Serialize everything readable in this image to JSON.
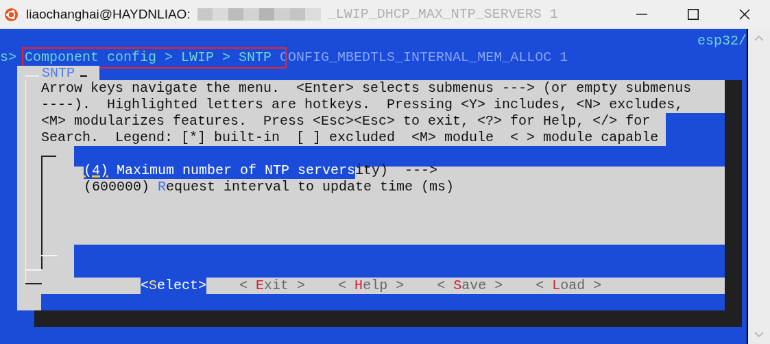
{
  "window": {
    "title": "liaochanghai@HAYDNLIAO:",
    "title_ghost": "_LWIP_DHCP_MAX_NTP_SERVERS 1"
  },
  "terminal": {
    "prompt_tail": "s>",
    "breadcrumb": "Component config > LWIP > SNTP",
    "breadcrumb_highlighted": true,
    "ghost_line": "CONFIG_MBEDTLS_INTERNAL_MEM_ALLOC 1",
    "path_tail": "esp32/"
  },
  "dialog": {
    "title": "SNTP",
    "help_lines": [
      "Arrow keys navigate the menu.  <Enter> selects submenus ---> (or empty submenus",
      "----).  Highlighted letters are hotkeys.  Pressing <Y> includes, <N> excludes,",
      "<M> modularizes features.  Press <Esc><Esc> to exit, <?> for Help, </> for",
      "Search.  Legend: [*] built-in  [ ] excluded  <M> module  < > module capable"
    ],
    "items": [
      {
        "setting": "(4)",
        "label": "Maximum number of NTP servers",
        "selected": true,
        "trailing": "ity)  --->"
      },
      {
        "setting": "(600000)",
        "label": "Request interval to update time (ms)",
        "selected": false
      }
    ],
    "buttons": [
      {
        "label": "<Select>",
        "selected": true
      },
      {
        "label": "< Exit >",
        "selected": false
      },
      {
        "label": "< Help >",
        "selected": false
      },
      {
        "label": "< Save >",
        "selected": false
      },
      {
        "label": "< Load >",
        "selected": false
      }
    ]
  }
}
